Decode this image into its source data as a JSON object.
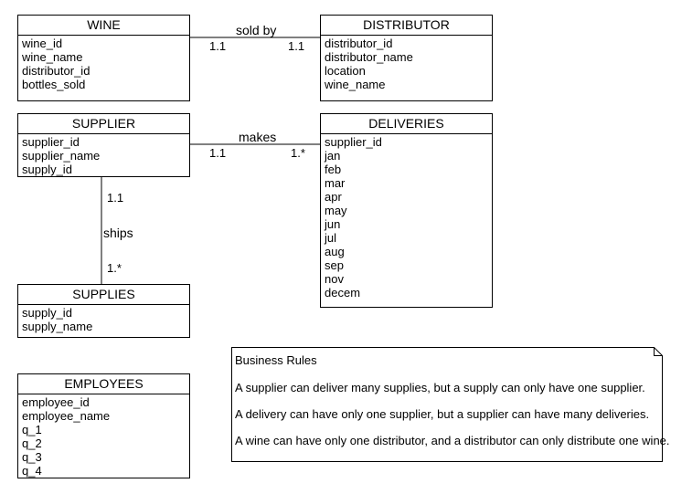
{
  "entities": {
    "wine": {
      "title": "WINE",
      "attributes": [
        "wine_id",
        "wine_name",
        "distributor_id",
        "bottles_sold"
      ]
    },
    "distributor": {
      "title": "DISTRIBUTOR",
      "attributes": [
        "distributor_id",
        "distributor_name",
        "location",
        "wine_name"
      ]
    },
    "supplier": {
      "title": "SUPPLIER",
      "attributes": [
        "supplier_id",
        "supplier_name",
        "supply_id"
      ]
    },
    "deliveries": {
      "title": "DELIVERIES",
      "attributes": [
        "supplier_id",
        "jan",
        "feb",
        "mar",
        "apr",
        "may",
        "jun",
        "jul",
        "aug",
        "sep",
        "nov",
        "decem"
      ]
    },
    "supplies": {
      "title": "SUPPLIES",
      "attributes": [
        "supply_id",
        "supply_name"
      ]
    },
    "employees": {
      "title": "EMPLOYEES",
      "attributes": [
        "employee_id",
        "employee_name",
        "q_1",
        "q_2",
        "q_3",
        "q_4"
      ]
    }
  },
  "relationships": {
    "sold_by": {
      "name": "sold by",
      "left_card": "1.1",
      "right_card": "1.1"
    },
    "makes": {
      "name": "makes",
      "left_card": "1.1",
      "right_card": "1.*"
    },
    "ships": {
      "name": "ships",
      "top_card": "1.1",
      "bottom_card": "1.*"
    }
  },
  "business_rules": {
    "title": "Business Rules",
    "rules": [
      "A supplier can deliver many supplies, but a supply can only have one supplier.",
      "A delivery can have only one supplier, but a supplier can have many deliveries.",
      "A wine can have only one distributor, and a distributor can only distribute one wine."
    ]
  }
}
